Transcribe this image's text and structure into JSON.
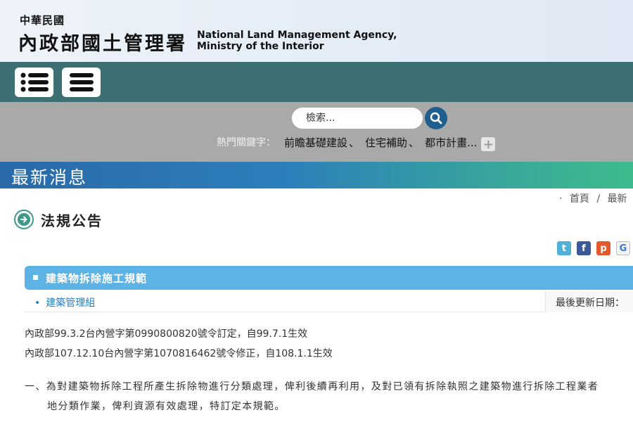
{
  "header": {
    "logo_small": "中華民國",
    "logo_big": "內政部國土管理署",
    "logo_en_line1": "National Land Management Agency,",
    "logo_en_line2": "Ministry of the Interior"
  },
  "nav": {
    "menu_icons": [
      "list-icon",
      "hamburger-icon"
    ]
  },
  "search": {
    "placeholder": "檢索...",
    "hot_label": "熱門關鍵字：",
    "keywords": [
      "前瞻基礎建設",
      "住宅補助",
      "都市計畫..."
    ],
    "separator": "、",
    "more_label": "+"
  },
  "banner": {
    "title": "最新消息"
  },
  "breadcrumb": {
    "bullet": "‧",
    "items": [
      "首頁",
      "最新"
    ],
    "separator": "/"
  },
  "section": {
    "title": "法規公告"
  },
  "share": {
    "twitter": "t",
    "facebook": "f",
    "plurk": "p",
    "google": "G"
  },
  "article": {
    "bullet": "■",
    "title": "建築物拆除施工規範",
    "org_bullet": "•",
    "org": "建築管理組",
    "update_label": "最後更新日期："
  },
  "content": {
    "line1": "內政部99.3.2台內營字第0990800820號令訂定，自99.7.1生效",
    "line2": "內政部107.12.10台內營字第1070816462號令修正，自108.1.1生效",
    "para_line1": "一、為對建築物拆除工程所產生拆除物進行分類處理，俾利後續再利用，及對已領有拆除執照之建築物進行拆除工程業者",
    "para_line2": "地分類作業，俾利資源有效處理，特訂定本規範。"
  },
  "colors": {
    "teal_bar": "#3d7073",
    "search_band": "#a9a9a9",
    "banner_start": "#2a6aa8",
    "banner_end": "#3dbb8c",
    "article_bar": "#5eb3e6",
    "link": "#2a7fc0"
  }
}
